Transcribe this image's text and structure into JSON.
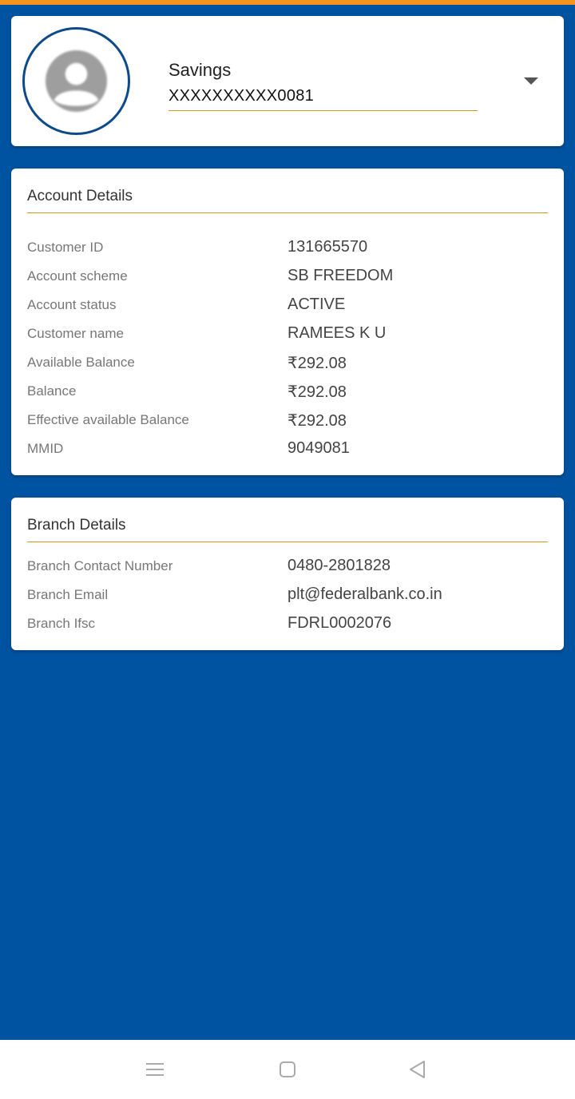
{
  "account_selector": {
    "account_type": "Savings",
    "account_number": "XXXXXXXXXX0081"
  },
  "account_details": {
    "title": "Account Details",
    "rows": [
      {
        "label": "Customer ID",
        "value": "131665570"
      },
      {
        "label": "Account scheme",
        "value": "SB FREEDOM"
      },
      {
        "label": "Account status",
        "value": "ACTIVE"
      },
      {
        "label": "Customer name",
        "value": "RAMEES K U"
      },
      {
        "label": "Available Balance",
        "value": "₹292.08"
      },
      {
        "label": "Balance",
        "value": "₹292.08"
      },
      {
        "label": "Effective available Balance",
        "value": "₹292.08"
      },
      {
        "label": "MMID",
        "value": "9049081"
      }
    ]
  },
  "branch_details": {
    "title": "Branch Details",
    "rows": [
      {
        "label": "Branch Contact Number",
        "value": "0480-2801828"
      },
      {
        "label": "Branch Email",
        "value": "plt@federalbank.co.in"
      },
      {
        "label": "Branch Ifsc",
        "value": "FDRL0002076"
      }
    ]
  },
  "navbar": {
    "items": [
      "menu-icon",
      "home-icon",
      "back-icon"
    ]
  },
  "colors": {
    "background": "#0053a0",
    "top_strip": "#f7941d",
    "accent_rule": "#d69a1c",
    "avatar_ring": "#0d4a8a"
  }
}
